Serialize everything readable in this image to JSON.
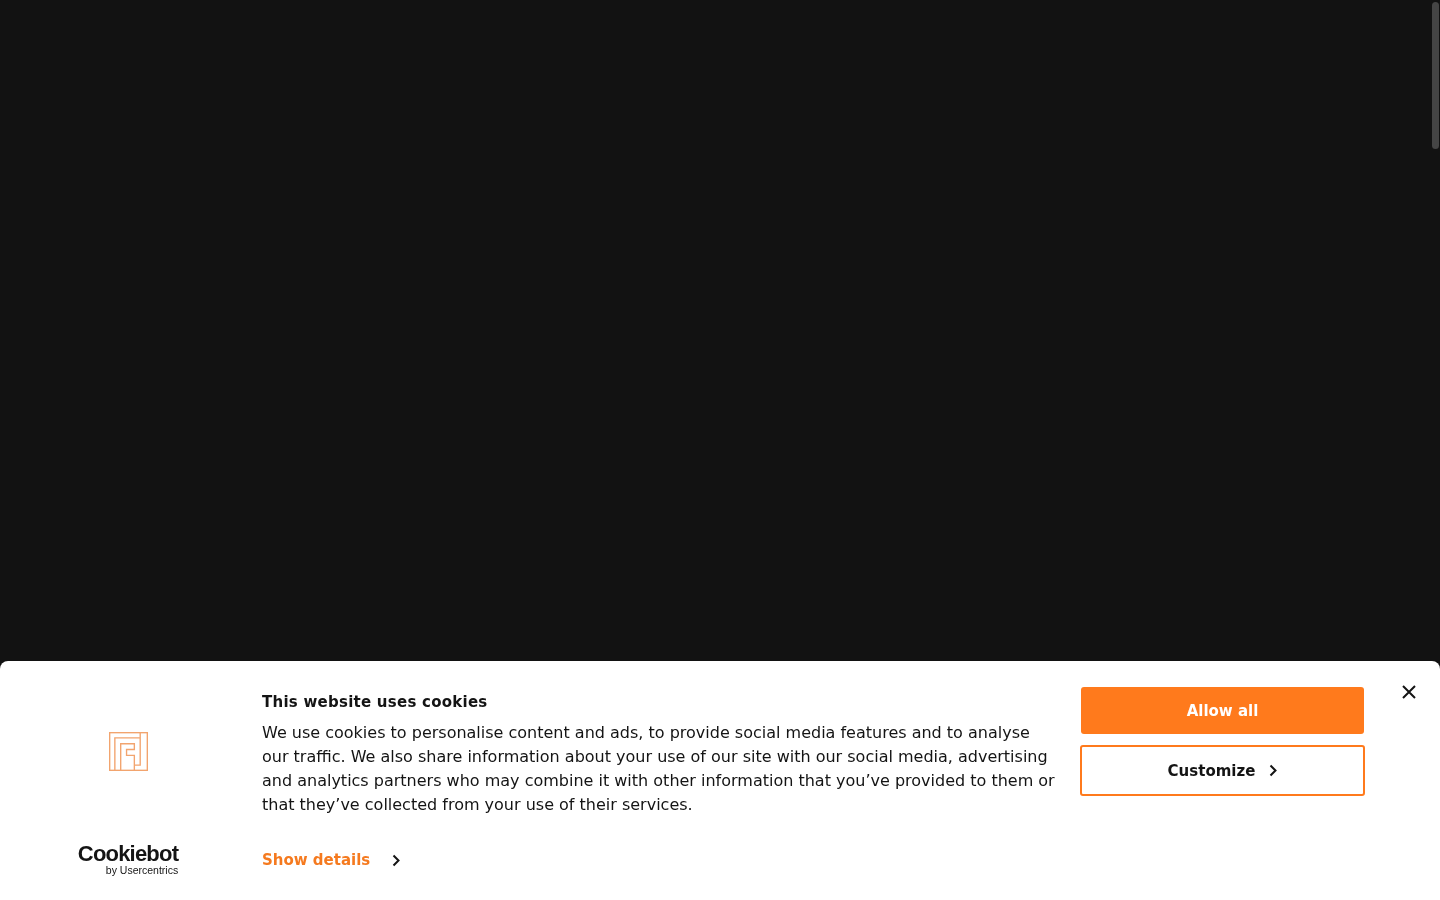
{
  "banner": {
    "brand": {
      "name": "Cookiebot",
      "tagline": "by Usercentrics"
    },
    "title": "This website uses cookies",
    "body": "We use cookies to personalise content and ads, to provide social media features and to analyse our traffic. We also share information about your use of our site with our social media, advertising and analytics partners who may combine it with other information that you’ve provided to them or that they’ve collected from your use of their services.",
    "details_link": "Show details",
    "buttons": [
      {
        "label": "Allow all",
        "kind": "primary"
      },
      {
        "label": "Customize",
        "kind": "secondary"
      }
    ]
  }
}
